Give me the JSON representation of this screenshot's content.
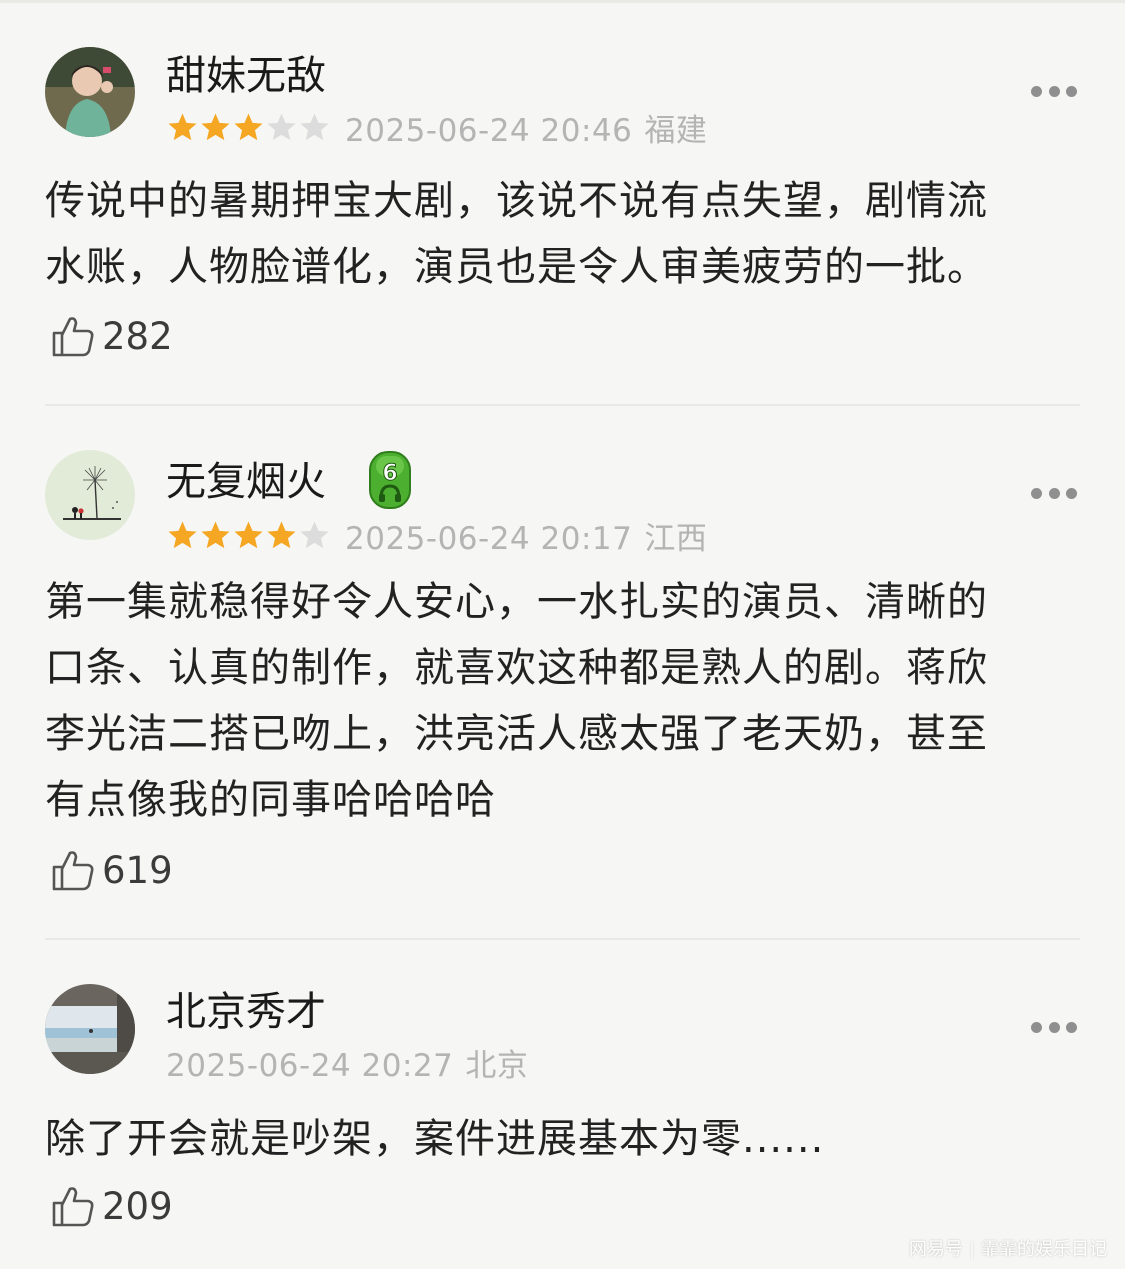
{
  "colors": {
    "background": "#f6f6f4",
    "star_filled": "#f5a623",
    "star_empty": "#dcdcdc",
    "meta_text": "#b4b4b4",
    "badge_green": "#4caf2f"
  },
  "comments": [
    {
      "username": "甜妹无敌",
      "rating": 3,
      "max_rating": 5,
      "timestamp": "2025-06-24 20:46",
      "region": "福建",
      "text_lines": [
        "传说中的暑期押宝大剧，该说不说有点失望，剧情流",
        "水账，人物脸谱化，演员也是令人审美疲劳的一批。"
      ],
      "likes": "282",
      "avatar_icon": "girl-avatar-icon",
      "more_icon": "more-dots-icon",
      "like_icon": "thumbs-up-icon"
    },
    {
      "username": "无复烟火",
      "level_badge": "6",
      "rating": 4,
      "max_rating": 5,
      "timestamp": "2025-06-24 20:17",
      "region": "江西",
      "text_lines": [
        "第一集就稳得好令人安心，一水扎实的演员、清晰的",
        "口条、认真的制作，就喜欢这种都是熟人的剧。蒋欣",
        "李光洁二搭已吻上，洪亮活人感太强了老天奶，甚至",
        "有点像我的同事哈哈哈哈"
      ],
      "likes": "619",
      "avatar_icon": "dandelion-avatar-icon",
      "more_icon": "more-dots-icon",
      "like_icon": "thumbs-up-icon"
    },
    {
      "username": "北京秀才",
      "timestamp": "2025-06-24 20:27",
      "region": "北京",
      "text_lines": [
        "除了开会就是吵架，案件进展基本为零......"
      ],
      "likes": "209",
      "avatar_icon": "sea-window-avatar-icon",
      "more_icon": "more-dots-icon",
      "like_icon": "thumbs-up-icon"
    }
  ],
  "watermark": {
    "brand": "网易号",
    "account": "霏霏的娱乐日记"
  }
}
